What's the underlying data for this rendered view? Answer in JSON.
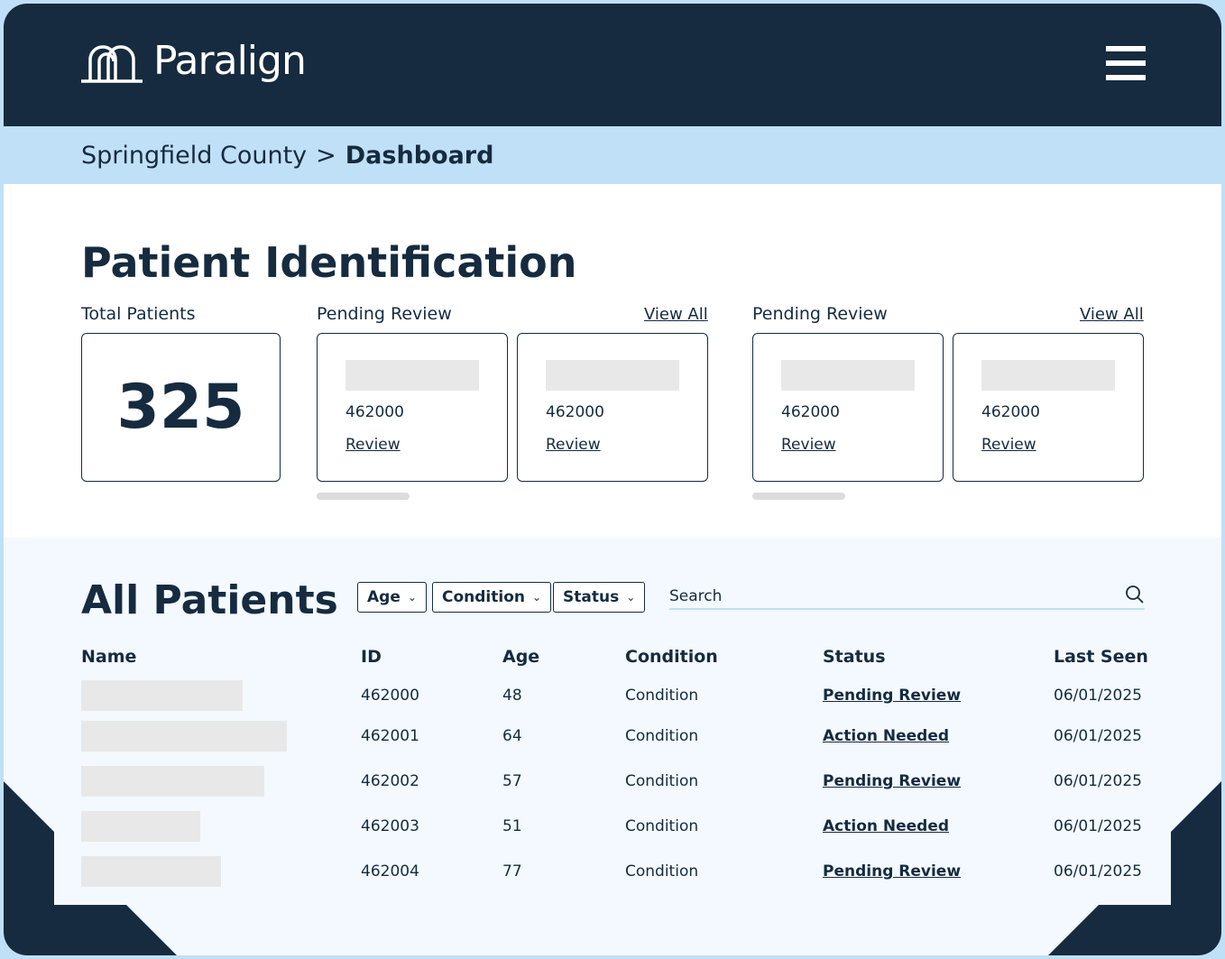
{
  "brand": {
    "name": "Paralign"
  },
  "breadcrumb": {
    "county": "Springfield County",
    "separator": ">",
    "current": "Dashboard"
  },
  "patient_identification": {
    "title": "Patient Identification",
    "total": {
      "label": "Total Patients",
      "value": "325"
    },
    "groups": [
      {
        "label": "Pending Review",
        "view_all": "View All",
        "cards": [
          {
            "id": "462000",
            "link": "Review"
          },
          {
            "id": "462000",
            "link": "Review"
          }
        ]
      },
      {
        "label": "Pending Review",
        "view_all": "View All",
        "cards": [
          {
            "id": "462000",
            "link": "Review"
          },
          {
            "id": "462000",
            "link": "Review"
          }
        ]
      }
    ]
  },
  "all_patients": {
    "title": "All Patients",
    "filters": [
      "Age",
      "Condition",
      "Status"
    ],
    "search": {
      "placeholder": "Search",
      "value": ""
    },
    "columns": [
      "Name",
      "ID",
      "Age",
      "Condition",
      "Status",
      "Last Seen"
    ],
    "rows": [
      {
        "id": "462000",
        "age": "48",
        "condition": "Condition",
        "status": "Pending Review",
        "last_seen": "06/01/2025"
      },
      {
        "id": "462001",
        "age": "64",
        "condition": "Condition",
        "status": "Action Needed",
        "last_seen": "06/01/2025"
      },
      {
        "id": "462002",
        "age": "57",
        "condition": "Condition",
        "status": "Pending Review",
        "last_seen": "06/01/2025"
      },
      {
        "id": "462003",
        "age": "51",
        "condition": "Condition",
        "status": "Action Needed",
        "last_seen": "06/01/2025"
      },
      {
        "id": "462004",
        "age": "77",
        "condition": "Condition",
        "status": "Pending Review",
        "last_seen": "06/01/2025"
      }
    ]
  },
  "colors": {
    "navy": "#162b3f",
    "light_blue": "#bfe0f7",
    "pale_blue": "#f3f9fe",
    "placeholder_gray": "#e8e8e8"
  },
  "icons": {
    "logo": "arch-logo-icon",
    "menu": "hamburger-menu-icon",
    "search": "search-icon",
    "chevron": "chevron-down-icon"
  }
}
